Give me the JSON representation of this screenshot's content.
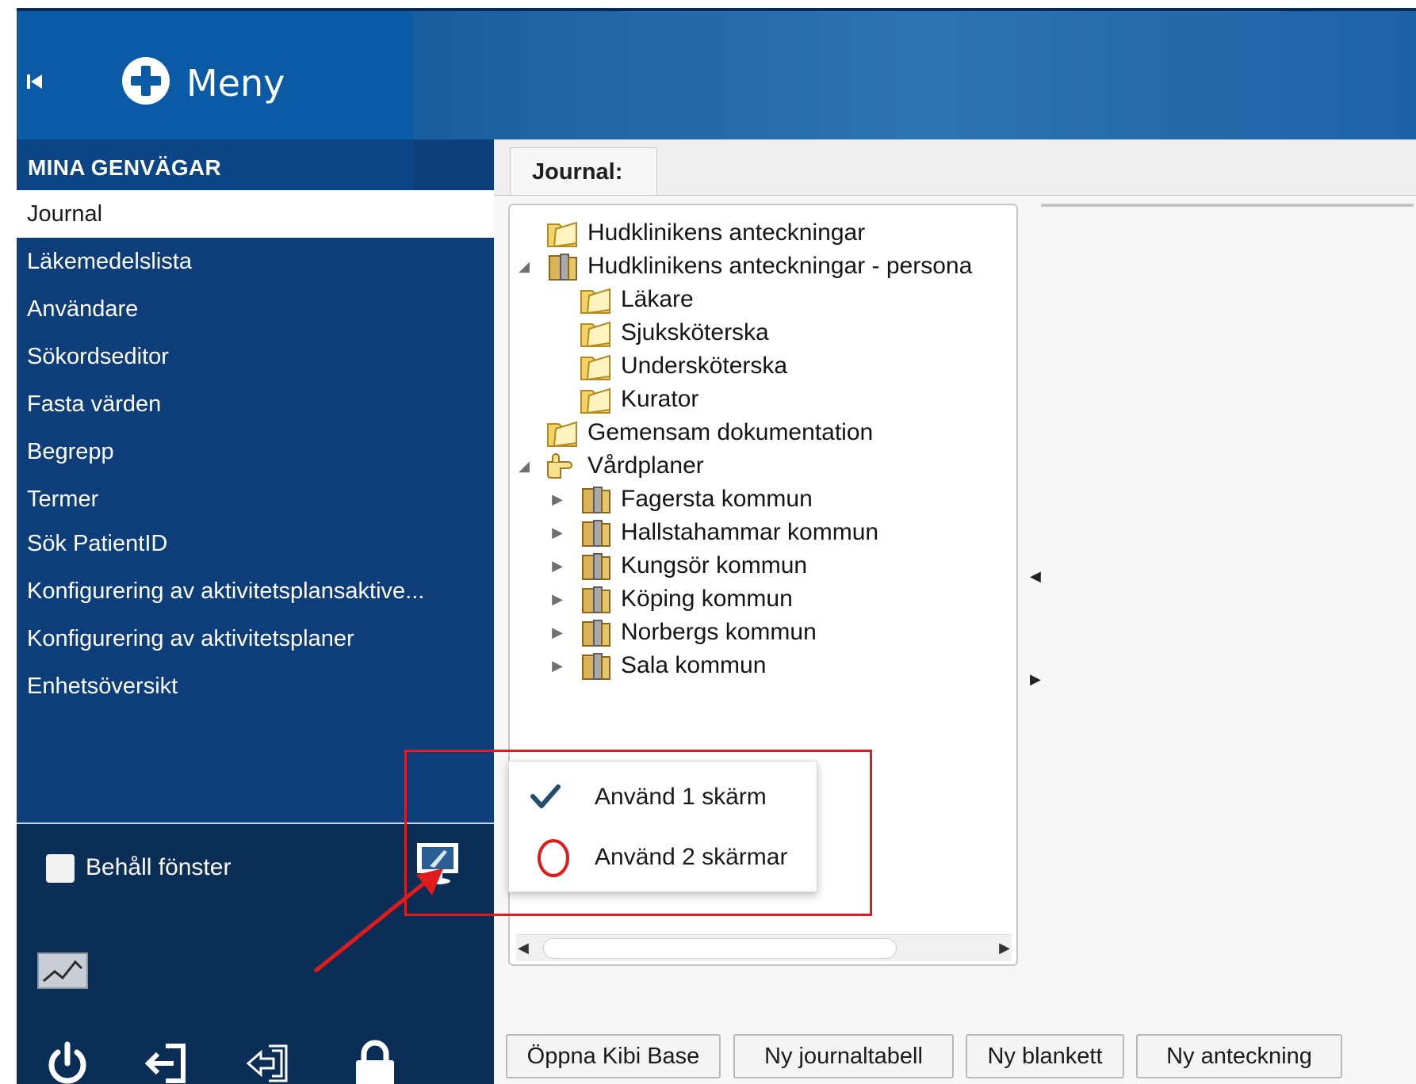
{
  "header": {
    "menu_label": "Meny"
  },
  "sidebar": {
    "section_title": "MINA GENVÄGAR",
    "items": [
      {
        "label": "Journal"
      },
      {
        "label": "Läkemedelslista"
      },
      {
        "label": "Användare"
      },
      {
        "label": "Sökordseditor"
      },
      {
        "label": "Fasta värden"
      },
      {
        "label": "Begrepp"
      },
      {
        "label": "Termer"
      },
      {
        "label": "Sök PatientID"
      },
      {
        "label": "Konfigurering av aktivitetsplansaktive..."
      },
      {
        "label": "Konfigurering av aktivitetsplaner"
      },
      {
        "label": "Enhetsöversikt"
      }
    ],
    "active_item": "Journal",
    "keep_window_label": "Behåll fönster",
    "keep_window_checked": false
  },
  "content": {
    "tab_label": "Journal:",
    "tree": [
      {
        "label": "Hudklinikens anteckningar"
      },
      {
        "label": "Hudklinikens anteckningar - persona"
      },
      {
        "label": "Läkare"
      },
      {
        "label": "Sjuksköterska"
      },
      {
        "label": "Undersköterska"
      },
      {
        "label": "Kurator"
      },
      {
        "label": "Gemensam dokumentation"
      },
      {
        "label": "Vårdplaner"
      },
      {
        "label": "Fagersta kommun"
      },
      {
        "label": "Hallstahammar kommun"
      },
      {
        "label": "Kungsör kommun"
      },
      {
        "label": "Köping kommun"
      },
      {
        "label": "Norbergs kommun"
      },
      {
        "label": "Sala kommun"
      }
    ],
    "buttons": [
      {
        "label": "Öppna Kibi Base"
      },
      {
        "label": "Ny journaltabell"
      },
      {
        "label": "Ny blankett"
      },
      {
        "label": "Ny anteckning"
      }
    ]
  },
  "display_menu": {
    "options": [
      {
        "label": "Använd 1 skärm",
        "selected": true
      },
      {
        "label": "Använd 2 skärmar",
        "selected": false
      }
    ]
  },
  "colors": {
    "header_blue": "#0b5aa6",
    "sidebar_blue": "#0d3e7a",
    "sidebar_bottom": "#0b2e56",
    "annotation_red": "#e01b1b",
    "check_teal": "#1f4e6e"
  },
  "icons": [
    "collapse-icon",
    "plus-circle-icon",
    "monitor-icon",
    "graph-icon",
    "power-icon",
    "logout-icon",
    "switch-user-icon",
    "lock-icon",
    "folder-icon",
    "checkmark-icon"
  ]
}
